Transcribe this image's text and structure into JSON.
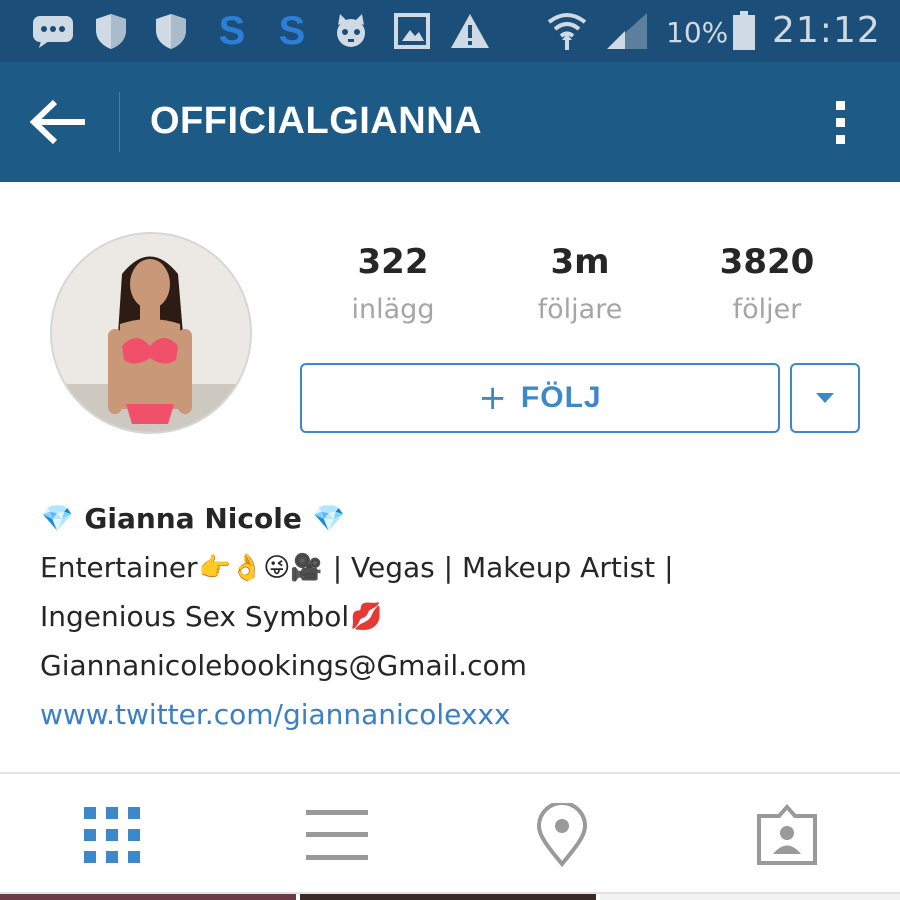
{
  "status_bar": {
    "icons": [
      "message-icon",
      "shield-icon",
      "shield-icon",
      "s-app-icon",
      "s-app-icon",
      "cat-icon",
      "image-icon",
      "warning-icon",
      "wifi-icon",
      "signal-icon",
      "battery-icon"
    ],
    "battery": "10%",
    "time": "21:12"
  },
  "app_bar": {
    "title": "OFFICIALGIANNA",
    "back_icon": "back-arrow-icon",
    "menu_icon": "overflow-menu-icon"
  },
  "profile": {
    "stats": [
      {
        "value": "322",
        "label": "inlägg"
      },
      {
        "value": "3m",
        "label": "följare"
      },
      {
        "value": "3820",
        "label": "följer"
      }
    ],
    "follow_label": "FÖLJ",
    "follow_icon": "plus-icon",
    "dropdown_icon": "caret-down-icon"
  },
  "bio": {
    "name_emoji": "💎",
    "name": "Gianna Nicole",
    "line2_text": "Entertainer",
    "line2_emojis": "👉👌😜🎥",
    "line2_rest": " | Vegas | Makeup Artist |",
    "line3_text": "Ingenious Sex Symbol",
    "line3_emoji": "💋",
    "email": "Giannanicolebookings@Gmail.com",
    "link": "www.twitter.com/giannanicolexxx"
  },
  "tabs": [
    {
      "icon": "grid-view-icon",
      "active": true
    },
    {
      "icon": "list-view-icon",
      "active": false
    },
    {
      "icon": "location-pin-icon",
      "active": false
    },
    {
      "icon": "tagged-photos-icon",
      "active": false
    }
  ],
  "colors": {
    "status_bar": "#1b4e78",
    "app_bar": "#1e5a86",
    "accent": "#3d88c9",
    "link": "#3b7fc4",
    "muted_text": "#a5a5a5",
    "inactive_icon": "#9a9a9a"
  }
}
